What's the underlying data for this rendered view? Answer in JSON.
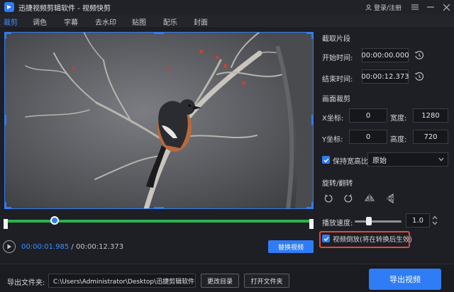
{
  "app": {
    "title": "迅捷视频剪辑软件 - 视频快剪",
    "login": "登录/注册"
  },
  "tabs": [
    {
      "label": "裁剪",
      "active": true
    },
    {
      "label": "调色",
      "active": false
    },
    {
      "label": "字幕",
      "active": false
    },
    {
      "label": "去水印",
      "active": false
    },
    {
      "label": "贴图",
      "active": false
    },
    {
      "label": "配乐",
      "active": false
    },
    {
      "label": "封面",
      "active": false
    }
  ],
  "player": {
    "current_time": "00:00:01.985",
    "separator": "/",
    "total_time": "00:00:12.373",
    "progress": 0.16,
    "replace_label": "替换视频"
  },
  "panel": {
    "clip_section": "截取片段",
    "start_label": "开始时间:",
    "start_value": "00:00:00.000",
    "end_label": "结束时间:",
    "end_value": "00:00:12.373",
    "crop_section": "画面裁剪",
    "x_label": "X坐标:",
    "x_value": "0",
    "width_label": "宽度:",
    "width_value": "1280",
    "y_label": "Y坐标:",
    "y_value": "0",
    "height_label": "高度:",
    "height_value": "720",
    "keep_ratio_label": "保持宽高比",
    "keep_ratio_checked": true,
    "ratio_value": "原始",
    "rotate_section": "旋转/翻转",
    "speed_label": "播放速度:",
    "speed_value": "1.0",
    "speed_slider": 0.3,
    "reverse_label": "视频倒放(将在转换后生效)",
    "reverse_checked": true
  },
  "bottom": {
    "export_folder_label": "导出文件夹:",
    "export_path": "C:\\Users\\Administrator\\Desktop\\迅捷剪辑软件",
    "change_dir_label": "更改目录",
    "open_folder_label": "打开文件夹",
    "export_label": "导出视频"
  },
  "colors": {
    "accent": "#2f7cf6",
    "timeline": "#2bb24c",
    "highlight": "#e24a33"
  }
}
